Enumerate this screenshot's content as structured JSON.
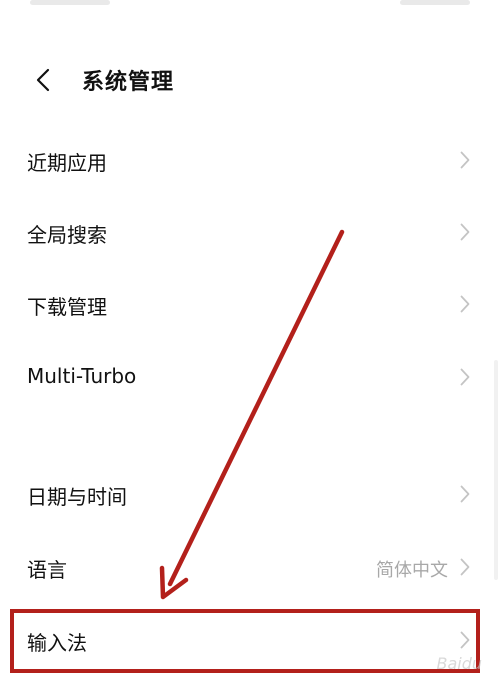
{
  "header": {
    "back_icon": "chevron-left-icon",
    "title": "系统管理"
  },
  "settings": {
    "items": [
      {
        "label": "近期应用"
      },
      {
        "label": "全局搜索"
      },
      {
        "label": "下载管理"
      },
      {
        "label": "Multi-Turbo"
      },
      {
        "label": "日期与时间"
      },
      {
        "label": "语言",
        "value": "简体中文"
      },
      {
        "label": "输入法"
      }
    ],
    "chevron_icon": "chevron-right-icon"
  },
  "annotation": {
    "highlight_color": "#b3201b"
  },
  "watermark": {
    "text": "Baidu"
  }
}
